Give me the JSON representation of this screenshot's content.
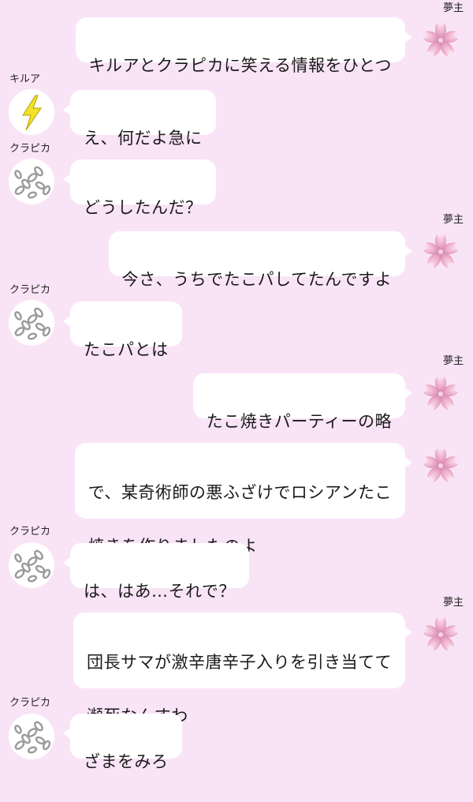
{
  "colors": {
    "background": "#f9e4f7",
    "bubble": "#ffffff",
    "sakura": "#e9a9c6",
    "lightning": "#f2e12a",
    "chain": "#9a9a9a"
  },
  "messages": [
    {
      "side": "right",
      "sender": "夢主",
      "avatar_icon": "sakura-icon",
      "lines": [
        "キルアとクラピカに笑える情報をひとつ"
      ]
    },
    {
      "side": "left",
      "sender": "キルア",
      "avatar_icon": "lightning-icon",
      "lines": [
        "え、何だよ急に"
      ]
    },
    {
      "side": "left",
      "sender": "クラピカ",
      "avatar_icon": "chain-icon",
      "lines": [
        "どうしたんだ？"
      ]
    },
    {
      "side": "right",
      "sender": "夢主",
      "avatar_icon": "sakura-icon",
      "lines": [
        "今さ、うちでたこパしてたんですよ"
      ]
    },
    {
      "side": "left",
      "sender": "クラピカ",
      "avatar_icon": "chain-icon",
      "lines": [
        "たこパとは"
      ]
    },
    {
      "side": "right",
      "sender": "夢主",
      "avatar_icon": "sakura-icon",
      "lines": [
        "たこ焼きパーティーの略"
      ]
    },
    {
      "side": "right",
      "sender": "",
      "avatar_icon": "sakura-icon",
      "lines": [
        "で、某奇術師の悪ふざけでロシアンたこ",
        "焼きを作りましたのよ"
      ]
    },
    {
      "side": "left",
      "sender": "クラピカ",
      "avatar_icon": "chain-icon",
      "lines": [
        "は、はあ…それで？"
      ]
    },
    {
      "side": "right",
      "sender": "夢主",
      "avatar_icon": "sakura-icon",
      "lines": [
        "団長サマが激辛唐辛子入りを引き当てて",
        "瀕死なんすわ"
      ]
    },
    {
      "side": "left",
      "sender": "クラピカ",
      "avatar_icon": "chain-icon",
      "lines": [
        "ざまをみろ"
      ]
    }
  ]
}
